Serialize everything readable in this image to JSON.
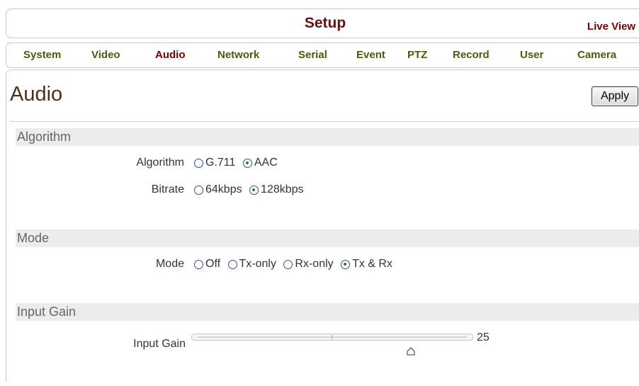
{
  "header": {
    "title": "Setup",
    "live_view": "Live View"
  },
  "nav": {
    "items": [
      {
        "label": "System",
        "active": false
      },
      {
        "label": "Video",
        "active": false
      },
      {
        "label": "Audio",
        "active": true
      },
      {
        "label": "Network",
        "active": false
      },
      {
        "label": "Serial",
        "active": false
      },
      {
        "label": "Event",
        "active": false
      },
      {
        "label": "PTZ",
        "active": false
      },
      {
        "label": "Record",
        "active": false
      },
      {
        "label": "User",
        "active": false
      },
      {
        "label": "Camera",
        "active": false
      }
    ]
  },
  "page": {
    "title": "Audio",
    "apply_label": "Apply"
  },
  "sections": {
    "algorithm": {
      "header": "Algorithm",
      "algorithm_label": "Algorithm",
      "algorithm_options": [
        "G.711",
        "AAC"
      ],
      "algorithm_selected": "AAC",
      "bitrate_label": "Bitrate",
      "bitrate_options": [
        "64kbps",
        "128kbps"
      ],
      "bitrate_selected": "128kbps"
    },
    "mode": {
      "header": "Mode",
      "mode_label": "Mode",
      "mode_options": [
        "Off",
        "Tx-only",
        "Rx-only",
        "Tx & Rx"
      ],
      "mode_selected": "Tx & Rx"
    },
    "input_gain": {
      "header": "Input Gain",
      "label": "Input Gain",
      "value": "25",
      "slider_fraction": 0.79
    }
  },
  "colors": {
    "title": "#6b0f0f",
    "nav_text": "#4b5a0f",
    "nav_active": "#7a0000",
    "section_bg": "#ececec",
    "radio_ring": "#2d4f9e",
    "radio_dot": "#2b7d2b"
  }
}
